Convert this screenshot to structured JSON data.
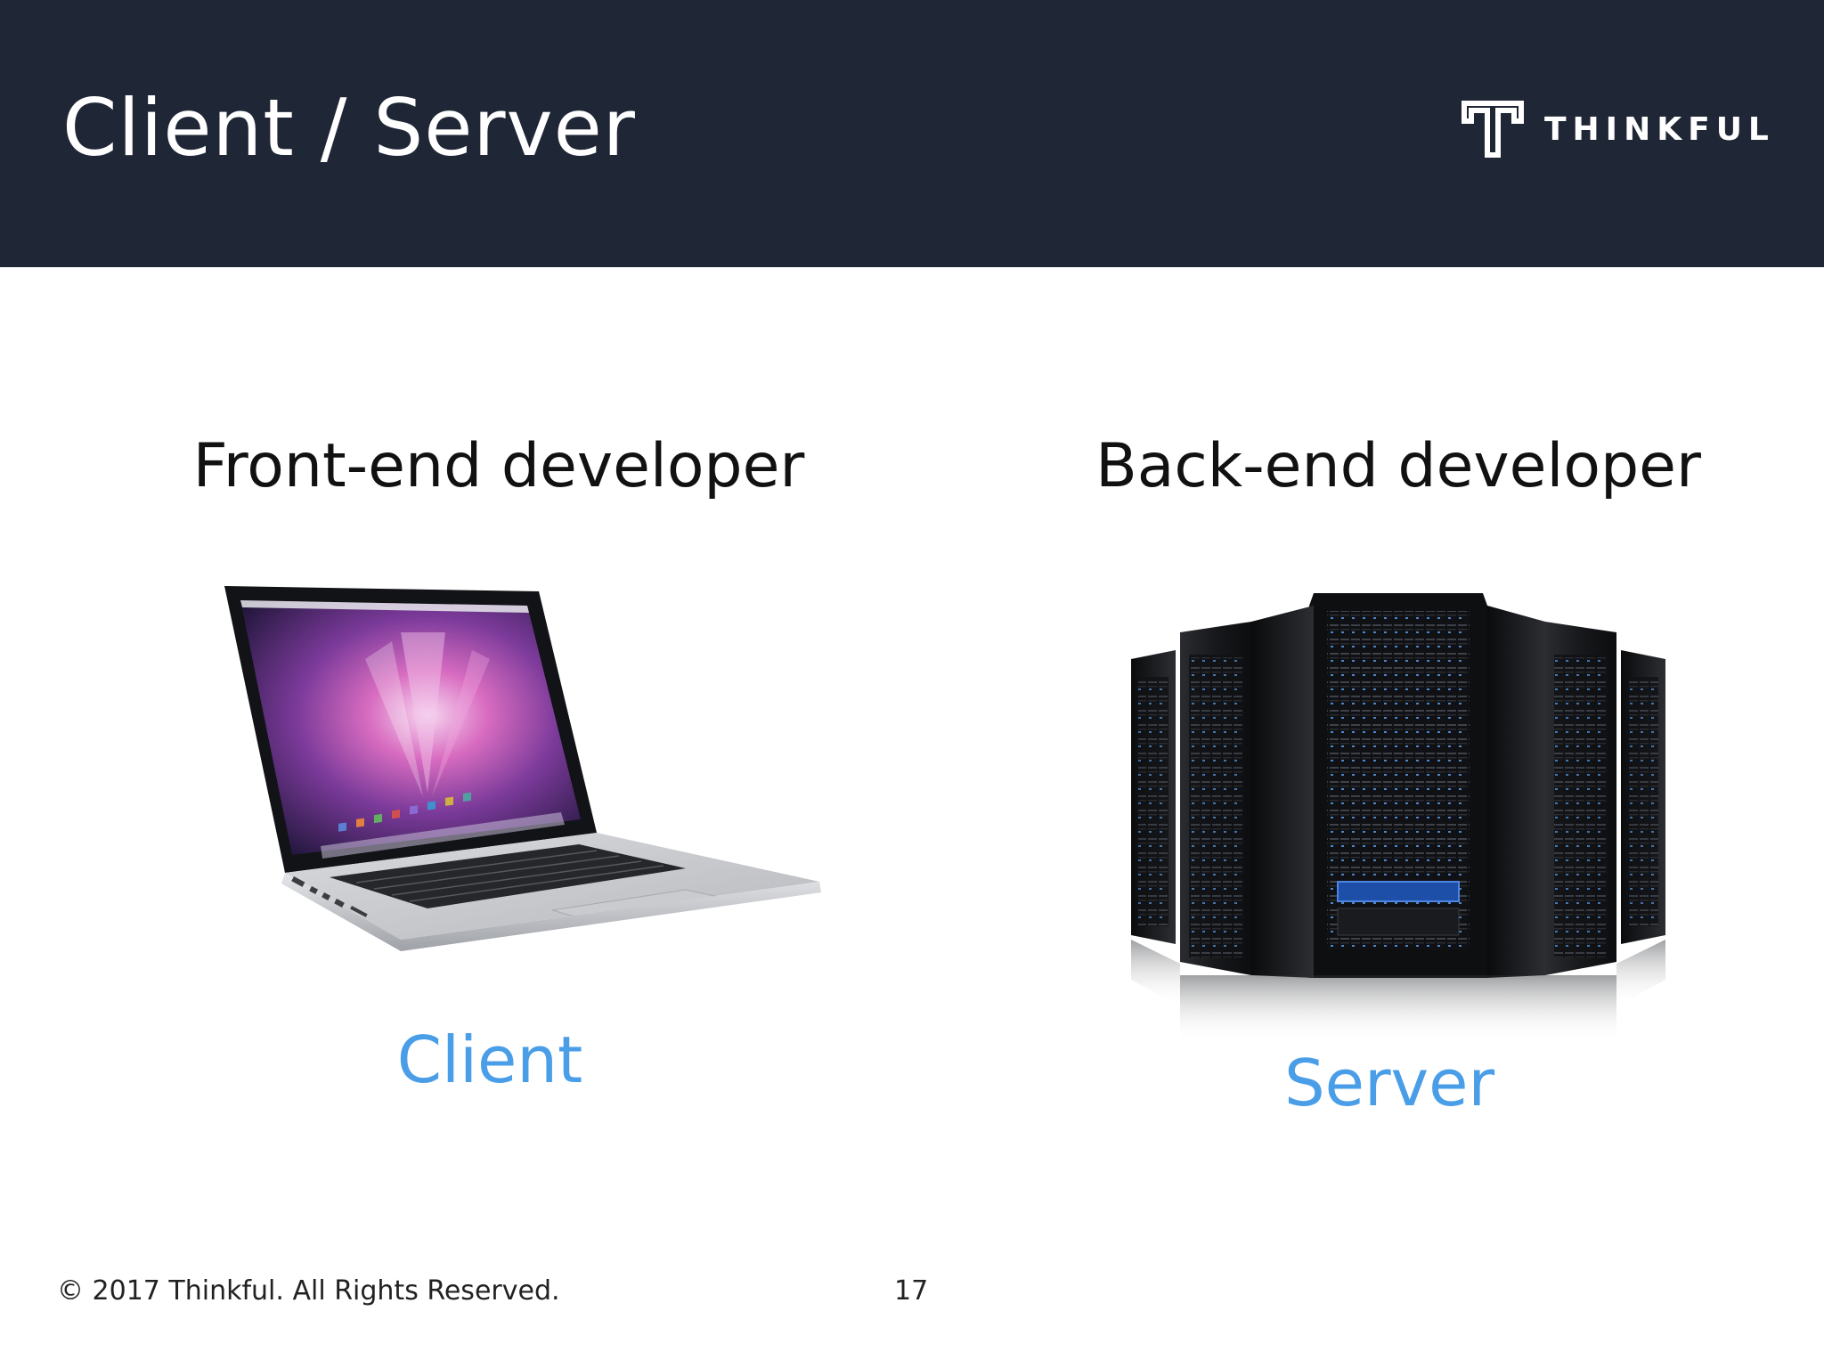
{
  "slide": {
    "title": "Client / Server",
    "page_number": "17"
  },
  "logo": {
    "text": "THINKFUL",
    "icon": "thinkful-logo-icon"
  },
  "columns": [
    {
      "role": "Front-end developer",
      "image": "laptop-image",
      "caption": "Client"
    },
    {
      "role": "Back-end developer",
      "image": "server-racks-image",
      "caption": "Server"
    }
  ],
  "footer": {
    "copyright": "© 2017 Thinkful. All Rights Reserved."
  },
  "colors": {
    "header_bg": "#1f2635",
    "caption": "#4a9ee8",
    "text": "#111111"
  }
}
